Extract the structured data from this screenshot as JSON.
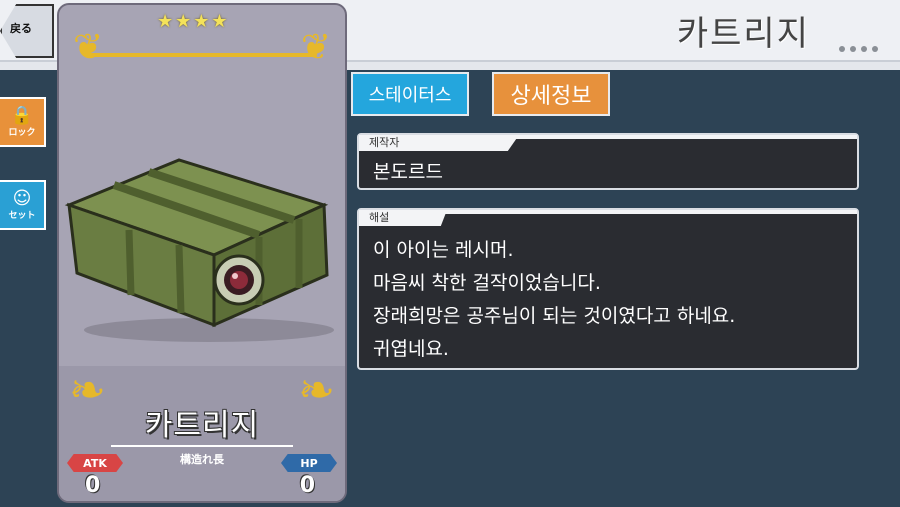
{
  "header": {
    "title": "카트리지",
    "back_label": "戻る",
    "more_icon": "ellipsis-icon"
  },
  "side_buttons": [
    {
      "label": "ロック",
      "icon": "lock-icon"
    },
    {
      "label": "セット",
      "icon": "set-icon"
    }
  ],
  "card": {
    "stars": "★★★★",
    "star_count": 4,
    "name": "카트리지",
    "signature": "構造れ長",
    "atk_label": "ATK",
    "atk_value": "0",
    "hp_label": "HP",
    "hp_value": "0",
    "item_icon": "cartridge-box-illustration"
  },
  "tabs": [
    {
      "label": "스테이터스",
      "color": "#24a6dd"
    },
    {
      "label": "상세정보",
      "color": "#e7913c",
      "active": true
    }
  ],
  "maker": {
    "label": "제작자",
    "value": "본도르드"
  },
  "description": {
    "label": "해설",
    "lines": [
      "이 아이는 레시머.",
      "마음씨 착한 걸작이었습니다.",
      "장래희망은 공주님이 되는 것이였다고 하네요.",
      "귀엽네요."
    ]
  }
}
